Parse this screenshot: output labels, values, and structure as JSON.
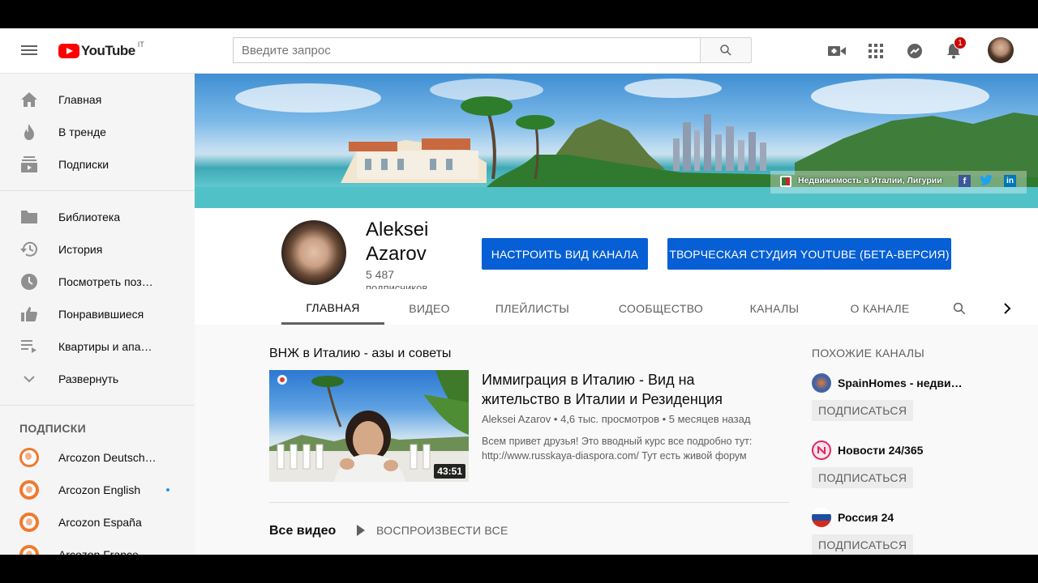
{
  "header": {
    "logo_text": "YouTube",
    "country": "IT",
    "search_placeholder": "Введите запрос",
    "notifications_count": "1",
    "icons": [
      "menu-icon",
      "search-icon",
      "create-video-icon",
      "apps-icon",
      "messages-icon",
      "bell-icon"
    ]
  },
  "sidebar": {
    "main_items": [
      {
        "label": "Главная",
        "icon": "home-icon"
      },
      {
        "label": "В тренде",
        "icon": "fire-icon"
      },
      {
        "label": "Подписки",
        "icon": "subscriptions-icon"
      }
    ],
    "library_items": [
      {
        "label": "Библиотека",
        "icon": "folder-icon"
      },
      {
        "label": "История",
        "icon": "history-icon"
      },
      {
        "label": "Посмотреть поз…",
        "icon": "clock-icon"
      },
      {
        "label": "Понравившиеся",
        "icon": "thumbs-up-icon"
      },
      {
        "label": "Квартиры и апа…",
        "icon": "playlist-icon"
      },
      {
        "label": "Развернуть",
        "icon": "chevron-down-icon"
      }
    ],
    "subscriptions_heading": "ПОДПИСКИ",
    "subscriptions": [
      {
        "label": "Arcozon Deutsch…",
        "new": false
      },
      {
        "label": "Arcozon English",
        "new": true
      },
      {
        "label": "Arcozon España",
        "new": false
      },
      {
        "label": "Arcozon France",
        "new": false
      }
    ]
  },
  "banner": {
    "caption": "Недвижимость в Италии, Лигурии",
    "social": [
      "facebook-icon",
      "twitter-icon",
      "linkedin-icon"
    ]
  },
  "channel": {
    "name": "Aleksei Azarov",
    "subscribers": "5 487",
    "subscribers_label": "подписчиков",
    "customize_button": "НАСТРОИТЬ ВИД КАНАЛА",
    "studio_button": "ТВОРЧЕСКАЯ СТУДИЯ YOUTUBE (БЕТА-ВЕРСИЯ)",
    "tabs": [
      "ГЛАВНАЯ",
      "ВИДЕО",
      "ПЛЕЙЛИСТЫ",
      "СООБЩЕСТВО",
      "КАНАЛЫ",
      "О КАНАЛЕ"
    ],
    "active_tab": "ГЛАВНАЯ"
  },
  "shelf": {
    "title": "ВНЖ в Италию - азы и советы",
    "video": {
      "title": "Иммиграция в Италию - Вид на жительство в Италии и Резиденция",
      "author": "Aleksei Azarov",
      "views": "4,6 тыс. просмотров",
      "age": "5 месяцев назад",
      "description": "Всем привет друзья! Это вводный курс все подробно тут: http://www.russkaya-diaspora.com/ Тут есть живой форум",
      "duration": "43:51"
    }
  },
  "all_videos": {
    "title": "Все видео",
    "play_all": "ВОСПРОИЗВЕСТИ ВСЕ"
  },
  "related": {
    "heading": "ПОХОЖИЕ КАНАЛЫ",
    "subscribe_label": "ПОДПИСАТЬСЯ",
    "channels": [
      {
        "name": "SpainHomes - недвиж…",
        "color": "#3a5fa8"
      },
      {
        "name": "Новости 24/365",
        "color": "#e0245e"
      },
      {
        "name": "Россия 24",
        "color": "#1f4fa0"
      }
    ]
  },
  "colors": {
    "accent_blue": "#065fd4",
    "brand_red": "#ff0000",
    "subscription_orange": "#f0792c"
  }
}
